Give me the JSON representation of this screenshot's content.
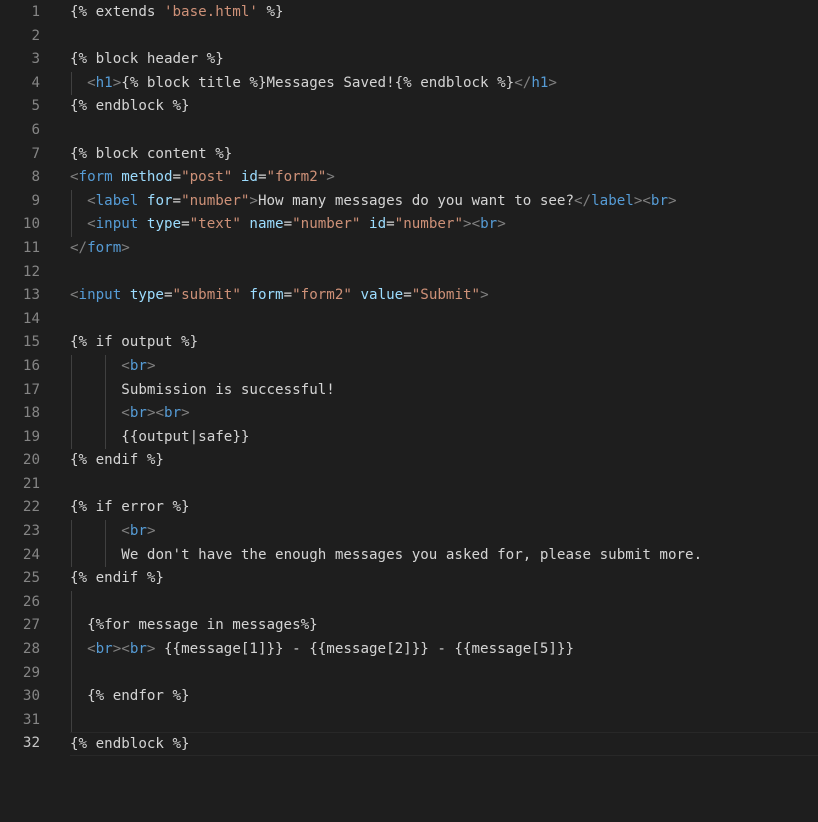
{
  "editor": {
    "lines": [
      {
        "n": "1",
        "segs": [
          [
            "tpl",
            "{% extends "
          ],
          [
            "jstr",
            "'base.html'"
          ],
          [
            "tpl",
            " %}"
          ]
        ]
      },
      {
        "n": "2",
        "segs": []
      },
      {
        "n": "3",
        "segs": [
          [
            "tpl",
            "{% block header %}"
          ]
        ]
      },
      {
        "n": "4",
        "indent": 2,
        "guides": [
          0
        ],
        "segs": [
          [
            "pun",
            "<"
          ],
          [
            "tag",
            "h1"
          ],
          [
            "pun",
            ">"
          ],
          [
            "tpl",
            "{% block title %}"
          ],
          [
            "txt",
            "Messages Saved!"
          ],
          [
            "tpl",
            "{% endblock %}"
          ],
          [
            "pun",
            "</"
          ],
          [
            "tag",
            "h1"
          ],
          [
            "pun",
            ">"
          ]
        ]
      },
      {
        "n": "5",
        "segs": [
          [
            "tpl",
            "{% endblock %}"
          ]
        ]
      },
      {
        "n": "6",
        "segs": []
      },
      {
        "n": "7",
        "segs": [
          [
            "tpl",
            "{% block content %}"
          ]
        ]
      },
      {
        "n": "8",
        "segs": [
          [
            "pun",
            "<"
          ],
          [
            "tag",
            "form"
          ],
          [
            "txt",
            " "
          ],
          [
            "attr",
            "method"
          ],
          [
            "txt",
            "="
          ],
          [
            "str",
            "\"post\""
          ],
          [
            "txt",
            " "
          ],
          [
            "attr",
            "id"
          ],
          [
            "txt",
            "="
          ],
          [
            "str",
            "\"form2\""
          ],
          [
            "pun",
            ">"
          ]
        ]
      },
      {
        "n": "9",
        "indent": 2,
        "guides": [
          0
        ],
        "segs": [
          [
            "pun",
            "<"
          ],
          [
            "tag",
            "label"
          ],
          [
            "txt",
            " "
          ],
          [
            "attr",
            "for"
          ],
          [
            "txt",
            "="
          ],
          [
            "str",
            "\"number\""
          ],
          [
            "pun",
            ">"
          ],
          [
            "txt",
            "How many messages do you want to see?"
          ],
          [
            "pun",
            "</"
          ],
          [
            "tag",
            "label"
          ],
          [
            "pun",
            ">"
          ],
          [
            "pun",
            "<"
          ],
          [
            "tag",
            "br"
          ],
          [
            "pun",
            ">"
          ]
        ]
      },
      {
        "n": "10",
        "indent": 2,
        "guides": [
          0
        ],
        "segs": [
          [
            "pun",
            "<"
          ],
          [
            "tag",
            "input"
          ],
          [
            "txt",
            " "
          ],
          [
            "attr",
            "type"
          ],
          [
            "txt",
            "="
          ],
          [
            "str",
            "\"text\""
          ],
          [
            "txt",
            " "
          ],
          [
            "attr",
            "name"
          ],
          [
            "txt",
            "="
          ],
          [
            "str",
            "\"number\""
          ],
          [
            "txt",
            " "
          ],
          [
            "attr",
            "id"
          ],
          [
            "txt",
            "="
          ],
          [
            "str",
            "\"number\""
          ],
          [
            "pun",
            ">"
          ],
          [
            "pun",
            "<"
          ],
          [
            "tag",
            "br"
          ],
          [
            "pun",
            ">"
          ]
        ]
      },
      {
        "n": "11",
        "segs": [
          [
            "pun",
            "</"
          ],
          [
            "tag",
            "form"
          ],
          [
            "pun",
            ">"
          ]
        ]
      },
      {
        "n": "12",
        "segs": []
      },
      {
        "n": "13",
        "segs": [
          [
            "pun",
            "<"
          ],
          [
            "tag",
            "input"
          ],
          [
            "txt",
            " "
          ],
          [
            "attr",
            "type"
          ],
          [
            "txt",
            "="
          ],
          [
            "str",
            "\"submit\""
          ],
          [
            "txt",
            " "
          ],
          [
            "attr",
            "form"
          ],
          [
            "txt",
            "="
          ],
          [
            "str",
            "\"form2\""
          ],
          [
            "txt",
            " "
          ],
          [
            "attr",
            "value"
          ],
          [
            "txt",
            "="
          ],
          [
            "str",
            "\"Submit\""
          ],
          [
            "pun",
            ">"
          ]
        ]
      },
      {
        "n": "14",
        "segs": []
      },
      {
        "n": "15",
        "segs": [
          [
            "tpl",
            "{% if output %}"
          ]
        ]
      },
      {
        "n": "16",
        "indent": 6,
        "guides": [
          0,
          4
        ],
        "segs": [
          [
            "pun",
            "<"
          ],
          [
            "tag",
            "br"
          ],
          [
            "pun",
            ">"
          ]
        ]
      },
      {
        "n": "17",
        "indent": 6,
        "guides": [
          0,
          4
        ],
        "segs": [
          [
            "txt",
            "Submission is successful!"
          ]
        ]
      },
      {
        "n": "18",
        "indent": 6,
        "guides": [
          0,
          4
        ],
        "segs": [
          [
            "pun",
            "<"
          ],
          [
            "tag",
            "br"
          ],
          [
            "pun",
            ">"
          ],
          [
            "pun",
            "<"
          ],
          [
            "tag",
            "br"
          ],
          [
            "pun",
            ">"
          ]
        ]
      },
      {
        "n": "19",
        "indent": 6,
        "guides": [
          0,
          4
        ],
        "segs": [
          [
            "tpl",
            "{{output|safe}}"
          ]
        ]
      },
      {
        "n": "20",
        "segs": [
          [
            "tpl",
            "{% endif %}"
          ]
        ]
      },
      {
        "n": "21",
        "segs": []
      },
      {
        "n": "22",
        "segs": [
          [
            "tpl",
            "{% if error %}"
          ]
        ]
      },
      {
        "n": "23",
        "indent": 6,
        "guides": [
          0,
          4
        ],
        "segs": [
          [
            "pun",
            "<"
          ],
          [
            "tag",
            "br"
          ],
          [
            "pun",
            ">"
          ]
        ]
      },
      {
        "n": "24",
        "indent": 6,
        "guides": [
          0,
          4
        ],
        "segs": [
          [
            "txt",
            "We don't have the enough messages you asked for, please submit more."
          ]
        ]
      },
      {
        "n": "25",
        "segs": [
          [
            "tpl",
            "{% endif %}"
          ]
        ]
      },
      {
        "n": "26",
        "guides": [
          0
        ],
        "segs": []
      },
      {
        "n": "27",
        "indent": 2,
        "guides": [
          0
        ],
        "segs": [
          [
            "tpl",
            "{%for message in messages%}"
          ]
        ]
      },
      {
        "n": "28",
        "indent": 2,
        "guides": [
          0
        ],
        "segs": [
          [
            "pun",
            "<"
          ],
          [
            "tag",
            "br"
          ],
          [
            "pun",
            ">"
          ],
          [
            "pun",
            "<"
          ],
          [
            "tag",
            "br"
          ],
          [
            "pun",
            ">"
          ],
          [
            "txt",
            " {{message[1]}} - {{message[2]}} - {{message[5]}}"
          ]
        ]
      },
      {
        "n": "29",
        "guides": [
          0
        ],
        "segs": []
      },
      {
        "n": "30",
        "indent": 2,
        "guides": [
          0
        ],
        "segs": [
          [
            "tpl",
            "{% endfor %}"
          ]
        ]
      },
      {
        "n": "31",
        "guides": [
          0
        ],
        "segs": []
      },
      {
        "n": "32",
        "active": true,
        "segs": [
          [
            "tpl",
            "{% endblock %}"
          ]
        ]
      }
    ]
  }
}
